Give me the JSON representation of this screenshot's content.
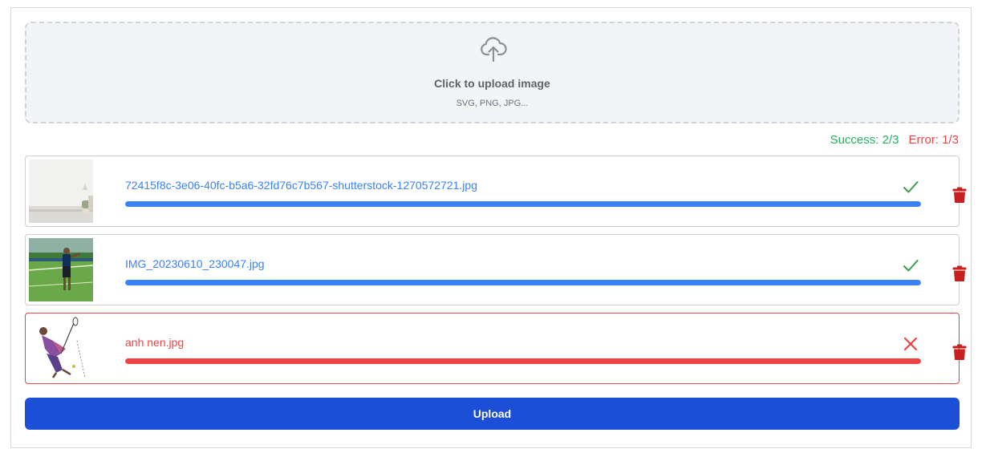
{
  "dropzone": {
    "title": "Click to upload image",
    "subtitle": "SVG, PNG, JPG...",
    "icon": "cloud-upload-icon"
  },
  "summary": {
    "success": "Success: 2/3",
    "error": "Error: 1/3"
  },
  "files": [
    {
      "name": "72415f8c-3e06-40fc-b5a6-32fd76c7b567-shutterstock-1270572721.jpg",
      "progress": 1.0,
      "status": "success",
      "status_icon": "check-icon"
    },
    {
      "name": "IMG_20230610_230047.jpg",
      "progress": 1.0,
      "status": "success",
      "status_icon": "check-icon"
    },
    {
      "name": "anh nen.jpg",
      "progress": 1.0,
      "status": "error",
      "status_icon": "close-icon"
    }
  ],
  "upload_button": "Upload",
  "colors": {
    "primary": "#1d4ed8",
    "progress": "#3b82f6",
    "success": "#22b35e",
    "error": "#ef4444",
    "check": "#3f9a4f",
    "trash": "#c81e1e"
  }
}
